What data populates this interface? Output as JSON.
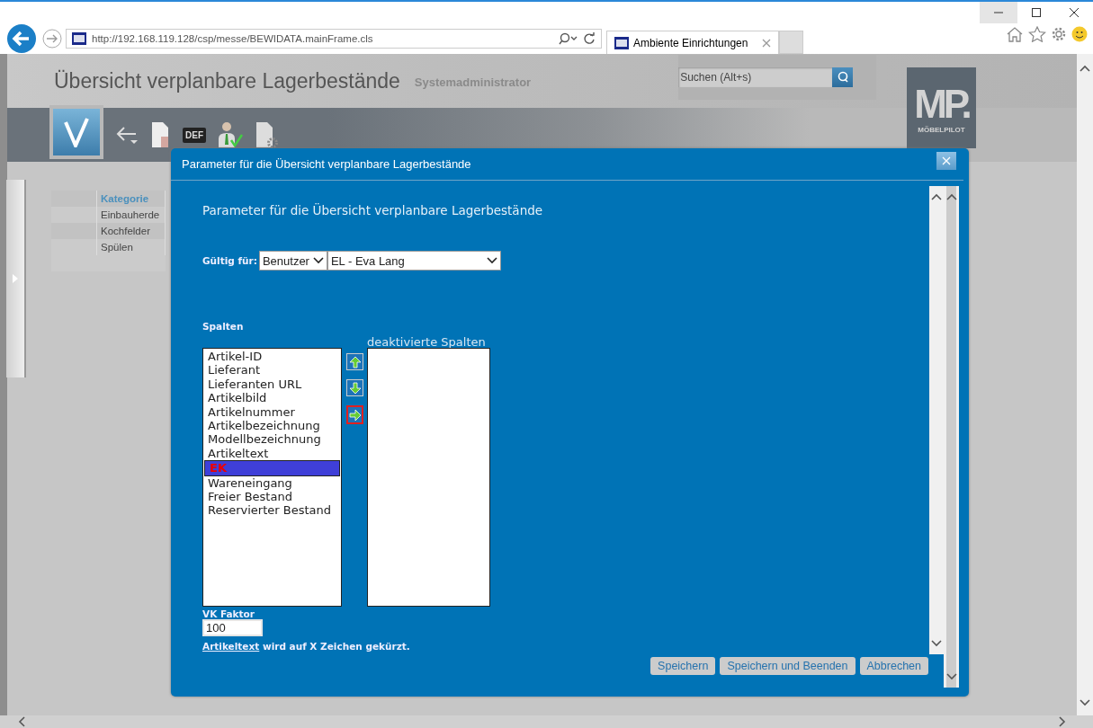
{
  "browser": {
    "address": "http://192.168.119.128/csp/messe/BEWIDATA.mainFrame.cls",
    "tabs": [
      {
        "title": "Ambiente Einrichtungen",
        "selected": true
      }
    ]
  },
  "header": {
    "title": "Übersicht verplanbare Lagerbestände",
    "user": "Systemadministrator",
    "search": {
      "placeholder": "Suchen (Alt+s)"
    },
    "logo": {
      "mark": "MP.",
      "name": "MÖBELPILOT"
    }
  },
  "toolbar": {
    "def_label": "DEF"
  },
  "category_table": {
    "columns": [
      "Kategorie"
    ],
    "rows": [
      "Einbauherde",
      "Kochfelder",
      "Spülen"
    ]
  },
  "dialog": {
    "title": "Parameter für die Übersicht verplanbare Lagerbestände",
    "heading": "Parameter für die Übersicht verplanbare Lagerbestände",
    "valid_for": {
      "label": "Gültig für:",
      "type_value": "Benutzer",
      "user_value": "EL - Eva Lang"
    },
    "columns_label": "Spalten",
    "disabled_columns_label": "deaktivierte Spalten",
    "columns": [
      {
        "name": "Artikel-ID",
        "selected": false
      },
      {
        "name": "Lieferant",
        "selected": false
      },
      {
        "name": "Lieferanten URL",
        "selected": false
      },
      {
        "name": "Artikelbild",
        "selected": false
      },
      {
        "name": "Artikelnummer",
        "selected": false
      },
      {
        "name": "Artikelbezeichnung",
        "selected": false
      },
      {
        "name": "Modellbezeichnung",
        "selected": false
      },
      {
        "name": "Artikeltext",
        "selected": false
      },
      {
        "name": "EK",
        "selected": true
      },
      {
        "name": "Wareneingang",
        "selected": false
      },
      {
        "name": "Freier Bestand",
        "selected": false
      },
      {
        "name": "Reservierter Bestand",
        "selected": false
      }
    ],
    "move_buttons": [
      {
        "kind": "up",
        "highlighted": false
      },
      {
        "kind": "down",
        "highlighted": false
      },
      {
        "kind": "right",
        "highlighted": true
      }
    ],
    "vk_factor": {
      "label": "VK Faktor",
      "value": "100"
    },
    "text_limit": {
      "link": "Artikeltext",
      "rest": "wird auf X Zeichen gekürzt."
    },
    "buttons": [
      "Speichern",
      "Speichern und Beenden",
      "Abbrechen"
    ]
  }
}
